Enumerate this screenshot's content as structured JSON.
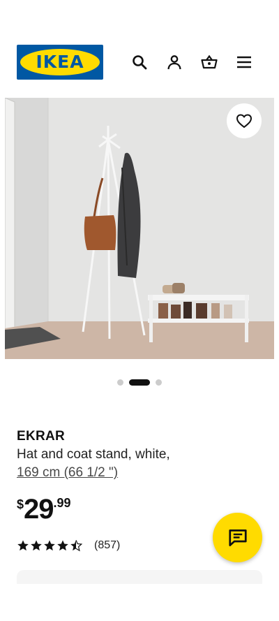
{
  "header": {
    "logo_text": "IKEA",
    "icons": [
      "search-icon",
      "user-icon",
      "basket-icon",
      "menu-icon"
    ]
  },
  "gallery": {
    "total_images": 3,
    "active_index": 1,
    "favorite_icon": "heart-icon"
  },
  "product": {
    "name": "EKRAR",
    "description": "Hat and coat stand, white,",
    "size": "169 cm (66 1/2 \")"
  },
  "price": {
    "currency": "$",
    "integer": "29",
    "decimal": ".99"
  },
  "rating": {
    "stars": 4.5,
    "max": 5,
    "count": "(857)"
  },
  "chat": {
    "icon": "chat-icon"
  },
  "colors": {
    "brand_blue": "#0058a3",
    "brand_yellow": "#ffdb00"
  }
}
